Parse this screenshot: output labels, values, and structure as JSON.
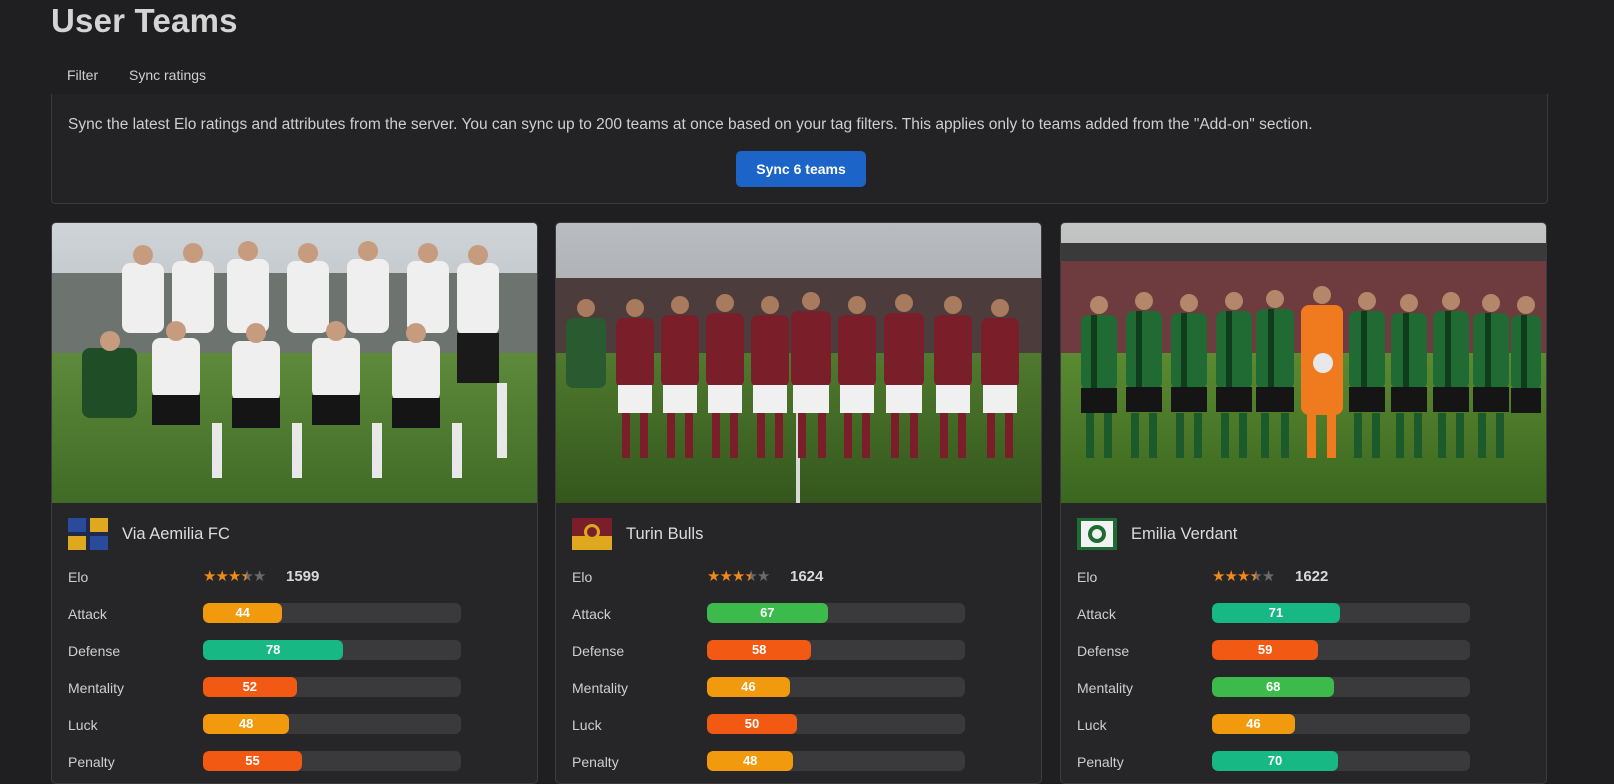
{
  "page": {
    "title": "User Teams"
  },
  "tabs": [
    {
      "label": "Filter",
      "active": false
    },
    {
      "label": "Sync ratings",
      "active": true
    }
  ],
  "sync": {
    "description": "Sync the latest Elo ratings and attributes from the server. You can sync up to 200 teams at once based on your tag filters. This applies only to teams added from the \"Add-on\" section.",
    "button_label": "Sync 6 teams"
  },
  "colors": {
    "orange": "#f29a0e",
    "red_orange": "#f25a14",
    "teal": "#17b884",
    "green": "#3cba4c",
    "accent_blue": "#1c64c8",
    "star": "#f08a1c"
  },
  "cards": [
    {
      "name": "Via Aemilia FC",
      "image_alt": "team photo, white kit",
      "elo": {
        "label": "Elo",
        "value": "1599",
        "stars": 3.5,
        "max_stars": 5
      },
      "stats": [
        {
          "label": "Attack",
          "value": 44,
          "color": "#f29a0e"
        },
        {
          "label": "Defense",
          "value": 78,
          "color": "#17b884"
        },
        {
          "label": "Mentality",
          "value": 52,
          "color": "#f25a14"
        },
        {
          "label": "Luck",
          "value": 48,
          "color": "#f29a0e"
        },
        {
          "label": "Penalty",
          "value": 55,
          "color": "#f25a14"
        }
      ]
    },
    {
      "name": "Turin Bulls",
      "image_alt": "team photo, maroon kit",
      "elo": {
        "label": "Elo",
        "value": "1624",
        "stars": 3.5,
        "max_stars": 5
      },
      "stats": [
        {
          "label": "Attack",
          "value": 67,
          "color": "#3cba4c"
        },
        {
          "label": "Defense",
          "value": 58,
          "color": "#f25a14"
        },
        {
          "label": "Mentality",
          "value": 46,
          "color": "#f29a0e"
        },
        {
          "label": "Luck",
          "value": 50,
          "color": "#f25a14"
        },
        {
          "label": "Penalty",
          "value": 48,
          "color": "#f29a0e"
        }
      ]
    },
    {
      "name": "Emilia Verdant",
      "image_alt": "team photo, green striped kit",
      "elo": {
        "label": "Elo",
        "value": "1622",
        "stars": 3.5,
        "max_stars": 5
      },
      "stats": [
        {
          "label": "Attack",
          "value": 71,
          "color": "#17b884"
        },
        {
          "label": "Defense",
          "value": 59,
          "color": "#f25a14"
        },
        {
          "label": "Mentality",
          "value": 68,
          "color": "#3cba4c"
        },
        {
          "label": "Luck",
          "value": 46,
          "color": "#f29a0e"
        },
        {
          "label": "Penalty",
          "value": 70,
          "color": "#17b884"
        }
      ]
    }
  ]
}
